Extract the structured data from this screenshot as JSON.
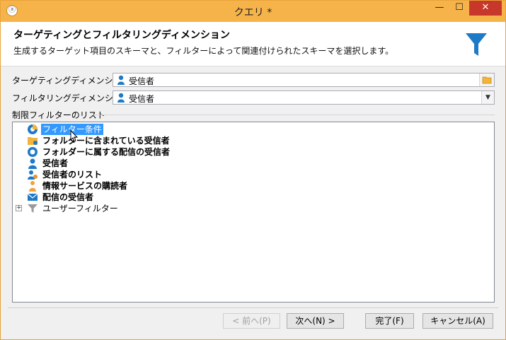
{
  "window": {
    "title": "クエリ *",
    "minimize": "—",
    "maximize": "☐",
    "close": "✕"
  },
  "header": {
    "title": "ターゲティングとフィルタリングディメンション",
    "description": "生成するターゲット項目のスキーマと、フィルターによって関連付けられたスキーマを選択します。"
  },
  "targeting": {
    "label": "ターゲティングディメンション:",
    "value": "受信者"
  },
  "filtering": {
    "label": "フィルタリングディメンション:",
    "value": "受信者"
  },
  "filter_list": {
    "label": "制限フィルターのリスト",
    "items": [
      {
        "label": "フィルター条件",
        "icon": "filter-condition-icon",
        "selected": true
      },
      {
        "label": "フォルダーに含まれている受信者",
        "icon": "folder-icon"
      },
      {
        "label": "フォルダーに属する配信の受信者",
        "icon": "delivery-icon"
      },
      {
        "label": "受信者",
        "icon": "person-icon"
      },
      {
        "label": "受信者のリスト",
        "icon": "recipient-list-icon"
      },
      {
        "label": "情報サービスの購読者",
        "icon": "subscriber-icon"
      },
      {
        "label": "配信の受信者",
        "icon": "mail-icon"
      },
      {
        "label": "ユーザーフィルター",
        "icon": "funnel-icon",
        "expandable": true
      }
    ]
  },
  "buttons": {
    "back": "< 前へ(P)",
    "next": "次へ(N) >",
    "finish": "完了(F)",
    "cancel": "キャンセル(A)"
  },
  "colors": {
    "titlebar": "#f6b34a",
    "accent": "#1e7ac6",
    "selection": "#3399ff",
    "close": "#c7372a"
  }
}
